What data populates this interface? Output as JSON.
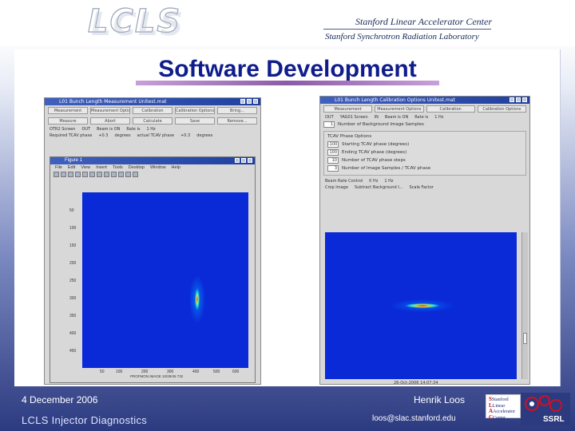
{
  "header": {
    "logo_text": "LCLS",
    "lab_line1": "Stanford Linear Accelerator Center",
    "lab_line2": "Stanford Synchrotron Radiation Laboratory"
  },
  "slide": {
    "title": "Software Development"
  },
  "window_left": {
    "title": "L01 Bunch Length Measurement Unitest.mat",
    "buttons": [
      "Measurement",
      "Measurement Options",
      "Calibration",
      "Calibration Options",
      "Bring..."
    ],
    "buttons2": [
      "Measure",
      "Abort",
      "Calculate",
      "Save",
      "Remove..."
    ],
    "info": [
      "OTR2 Screen",
      "OUT",
      "Beam is ON",
      "Rate is",
      "1 Hz"
    ],
    "info2": [
      "Required TCAV phase",
      "+0.3",
      "degrees",
      "actual TCAV phase",
      "+0.3",
      "degrees"
    ],
    "figure": {
      "title": "Figure 1",
      "menu": [
        "File",
        "Edit",
        "View",
        "Insert",
        "Tools",
        "Desktop",
        "Window",
        "Help"
      ],
      "y_ticks": [
        "50",
        "100",
        "150",
        "200",
        "250",
        "300",
        "350",
        "400",
        "450"
      ],
      "x_ticks": [
        "50",
        "100",
        "200",
        "300",
        "400",
        "500",
        "600"
      ],
      "x_label": "PROFMON IMAGE 10/29/45 732"
    }
  },
  "window_right": {
    "title": "L01 Bunch Length Calibration Options Unitest.mat",
    "buttons": [
      "Measurement",
      "Measurement Options",
      "Calibration",
      "Calibration Options"
    ],
    "info": [
      "OUT",
      "YAG01 Screen",
      "IN",
      "Beam is ON",
      "Rate is",
      "1 Hz"
    ],
    "bg_label": "Number of Background Image Samples",
    "bg_value": "1",
    "panel_title": "TCAV Phase Options",
    "phase_rows": [
      {
        "value": "-100",
        "label": "Starting TCAV phase (degrees)"
      },
      {
        "value": "100",
        "label": "Ending TCAV phase (degrees)"
      },
      {
        "value": "10",
        "label": "Number of TCAV phase steps"
      },
      {
        "value": "3",
        "label": "Number of Image Samples / TCAV phase"
      }
    ],
    "beam_rate_label": "Beam Rate Control",
    "rate_options": [
      "0 Hz",
      "1 Hz"
    ],
    "checkbox1": "Crop Image",
    "checkbox2": "Subtract Background I...",
    "scale_label": "Scale Factor",
    "plot_date": "26-Oct-2006 14:07:34"
  },
  "footer": {
    "date": "4 December 2006",
    "title": "LCLS Injector Diagnostics",
    "author": "Henrik Loos",
    "email": "loos@slac.stanford.edu",
    "slac_lines": [
      "Stanford",
      "Linear",
      "Accelerator",
      "Center"
    ],
    "ssrl_text": "SSRL"
  }
}
